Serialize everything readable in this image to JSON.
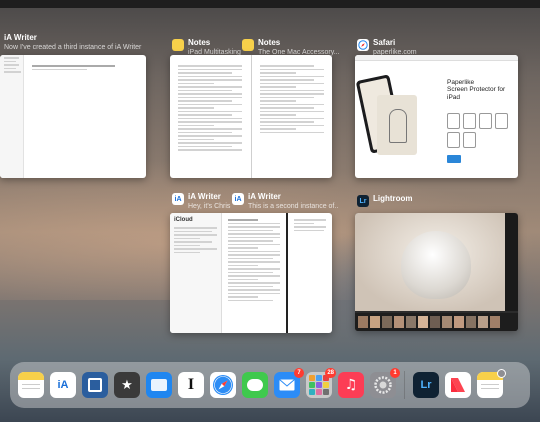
{
  "switcher": {
    "cards": [
      {
        "app": "iA Writer",
        "subtitle": "Now I've created a third instance of iA Writer"
      },
      {
        "app": "Notes",
        "subtitle": "iPad Multitasking"
      },
      {
        "app": "Notes",
        "subtitle": "The One Mac Accessory..."
      },
      {
        "app": "Safari",
        "subtitle": "paperlike.com"
      },
      {
        "app": "iA Writer",
        "subtitle": "Hey, it's Chris"
      },
      {
        "app": "iA Writer",
        "subtitle": "This is a second instance of..."
      },
      {
        "app": "Lightroom",
        "subtitle": ""
      }
    ],
    "paperlike": {
      "brand": "Paperlike",
      "headline": "Screen Protector for iPad"
    },
    "icloud_label": "iCloud"
  },
  "dock": {
    "apps": [
      {
        "name": "Notes",
        "icon": "notes-icon",
        "color": "#f7d04a"
      },
      {
        "name": "iA Writer",
        "icon": "ia-writer-icon",
        "color": "#ffffff",
        "glyph": "iA"
      },
      {
        "name": "Screens",
        "icon": "screens-icon",
        "color": "#2b5e9e"
      },
      {
        "name": "Reeder",
        "icon": "star-icon",
        "color": "#3a3a3a",
        "glyph": "★"
      },
      {
        "name": "Files",
        "icon": "files-icon",
        "color": "#1f86f0"
      },
      {
        "name": "Instapaper",
        "icon": "instapaper-icon",
        "color": "#ffffff",
        "glyph": "I"
      },
      {
        "name": "Safari",
        "icon": "safari-icon",
        "color": "#ffffff"
      },
      {
        "name": "Messages",
        "icon": "messages-icon",
        "color": "#3fc94d"
      },
      {
        "name": "Mail",
        "icon": "mail-icon",
        "color": "#2b8cf7",
        "badge": "7"
      },
      {
        "name": "Folder",
        "icon": "folder-icon",
        "color": "#c9c9c9",
        "badge": "28"
      },
      {
        "name": "Music",
        "icon": "music-icon",
        "color": "#fc3d55",
        "glyph": "♫"
      },
      {
        "name": "Settings",
        "icon": "settings-icon",
        "color": "#8e8e93",
        "badge": "1"
      },
      {
        "name": "Lightroom",
        "icon": "lightroom-icon",
        "color": "#0f2233",
        "glyph": "Lr"
      },
      {
        "name": "News",
        "icon": "news-icon",
        "color": "#ffffff"
      },
      {
        "name": "Notes",
        "icon": "notes-recent-icon",
        "color": "#f7d04a"
      }
    ]
  }
}
